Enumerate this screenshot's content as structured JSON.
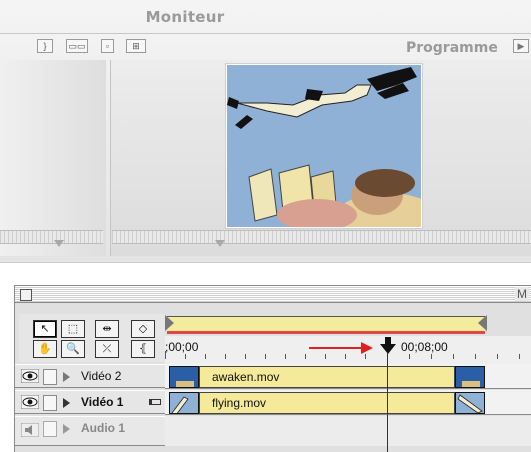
{
  "monitor": {
    "title": "Moniteur",
    "program_label": "Programme"
  },
  "timeline": {
    "title": "M",
    "timecode_start": ";00;00",
    "timecode_marker": "00;08;00",
    "tracks": [
      {
        "label": "Vidéo 2",
        "clip": "awaken.mov"
      },
      {
        "label": "Vidéo 1",
        "clip": "flying.mov"
      },
      {
        "label": "Audio 1",
        "clip": ""
      }
    ]
  },
  "colors": {
    "clip_fill": "#f4ea9a",
    "work_area_red": "#e04848",
    "annotation_arrow": "#e02020",
    "preview_sky": "#8fb1d6"
  }
}
